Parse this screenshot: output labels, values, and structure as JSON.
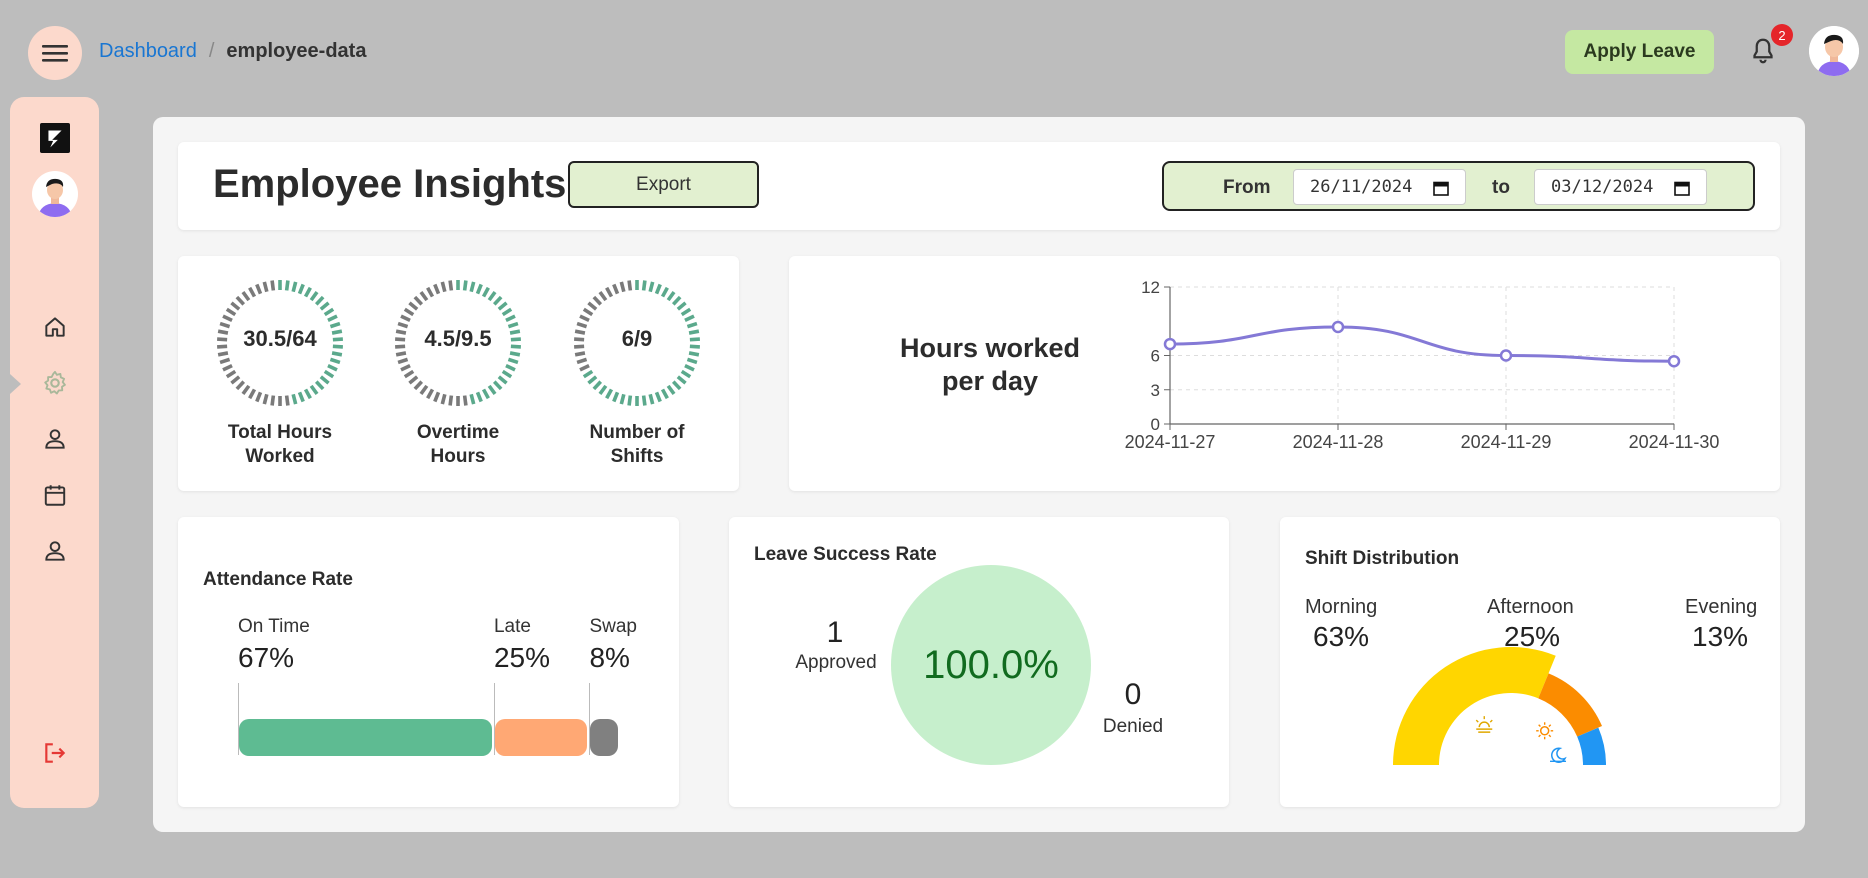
{
  "breadcrumb": {
    "link": "Dashboard",
    "separator": "/",
    "current": "employee-data"
  },
  "header": {
    "apply_leave_label": "Apply Leave",
    "notification_count": "2"
  },
  "page": {
    "title": "Employee Insights",
    "export_label": "Export"
  },
  "date_range": {
    "from_label": "From",
    "from_value": "26/11/2024",
    "to_label": "to",
    "to_value": "03/12/2024"
  },
  "gauges": [
    {
      "value_text": "30.5/64",
      "label_line1": "Total Hours",
      "label_line2": "Worked",
      "fraction": 0.4766
    },
    {
      "value_text": "4.5/9.5",
      "label_line1": "Overtime",
      "label_line2": "Hours",
      "fraction": 0.4737
    },
    {
      "value_text": "6/9",
      "label_line1": "Number of",
      "label_line2": "Shifts",
      "fraction": 0.6667
    }
  ],
  "hours_chart": {
    "title_line1": "Hours worked",
    "title_line2": "per day"
  },
  "chart_data": {
    "type": "line",
    "title": "Hours worked per day",
    "x": [
      "2024-11-27",
      "2024-11-28",
      "2024-11-29",
      "2024-11-30"
    ],
    "series": [
      {
        "values": [
          7,
          8.5,
          6,
          5.5
        ],
        "color": "#8479d6"
      }
    ],
    "yticks": [
      0,
      3,
      6,
      12
    ],
    "ylim": [
      0,
      12
    ],
    "grid": true
  },
  "attendance": {
    "heading": "Attendance Rate",
    "items": [
      {
        "label": "On Time",
        "value": "67%",
        "percent": 67,
        "color": "#5ebb92"
      },
      {
        "label": "Late",
        "value": "25%",
        "percent": 25,
        "color": "#ffa874"
      },
      {
        "label": "Swap",
        "value": "8%",
        "percent": 8,
        "color": "#808080"
      }
    ]
  },
  "leave": {
    "heading": "Leave Success Rate",
    "approved_count": "1",
    "approved_label": "Approved",
    "rate": "100.0%",
    "denied_count": "0",
    "denied_label": "Denied"
  },
  "shift": {
    "heading": "Shift Distribution",
    "items": [
      {
        "label": "Morning",
        "value": "63%",
        "percent": 63,
        "color": "#ffd600",
        "icon": "sunrise-icon"
      },
      {
        "label": "Afternoon",
        "value": "25%",
        "percent": 25,
        "color": "#fb8c00",
        "icon": "sun-icon"
      },
      {
        "label": "Evening",
        "value": "13%",
        "percent": 13,
        "color": "#2196f3",
        "icon": "moon-icon"
      }
    ]
  },
  "colors": {
    "gauge_filled": "#5ba98c",
    "gauge_empty": "#7a7a7a",
    "sidebar_bg": "#fcd9cc",
    "accent_link": "#1976d2"
  }
}
